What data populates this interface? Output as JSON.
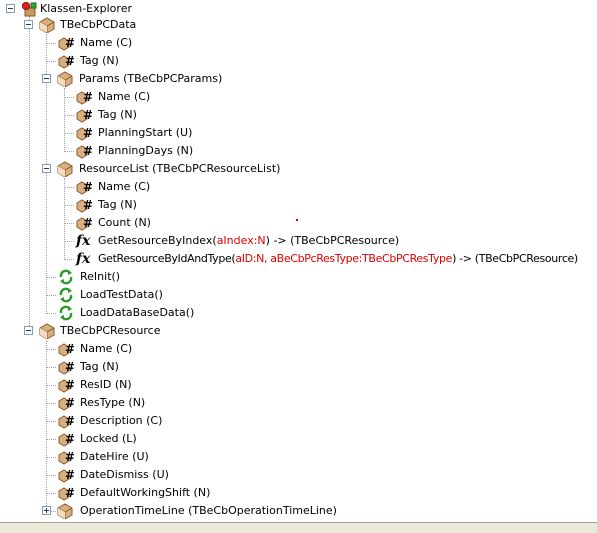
{
  "tree": {
    "root": "Klassen-Explorer",
    "items": [
      {
        "label": "TBeCbPCData",
        "type": "box"
      },
      {
        "label": "Name (C)",
        "type": "field"
      },
      {
        "label": "Tag (N)",
        "type": "field"
      },
      {
        "label": "Params (TBeCbPCParams)",
        "type": "box"
      },
      {
        "label": "Name (C)",
        "type": "field"
      },
      {
        "label": "Tag (N)",
        "type": "field"
      },
      {
        "label": "PlanningStart (U)",
        "type": "field"
      },
      {
        "label": "PlanningDays (N)",
        "type": "field"
      },
      {
        "label": "ResourceList (TBeCbPCResourceList)",
        "type": "box"
      },
      {
        "label": "Name (C)",
        "type": "field"
      },
      {
        "label": "Tag (N)",
        "type": "field"
      },
      {
        "label": "Count (N)",
        "type": "field"
      },
      {
        "label": "GetResourceByIndex(",
        "param": "aIndex:N",
        "suffix": ") -> (TBeCbPCResource)",
        "type": "function"
      },
      {
        "label": "GetResourceByIdAndType(",
        "param": "aID:N, aBeCbPcResType:TBeCbPCResType",
        "suffix": ") -> (TBeCbPCResource)",
        "type": "function"
      },
      {
        "label": "ReInit()",
        "type": "method"
      },
      {
        "label": "LoadTestData()",
        "type": "method"
      },
      {
        "label": "LoadDataBaseData()",
        "type": "method"
      },
      {
        "label": "TBeCbPCResource",
        "type": "box"
      },
      {
        "label": "Name (C)",
        "type": "field"
      },
      {
        "label": "Tag (N)",
        "type": "field"
      },
      {
        "label": "ResID (N)",
        "type": "field"
      },
      {
        "label": "ResType (N)",
        "type": "field"
      },
      {
        "label": "Description (C)",
        "type": "field"
      },
      {
        "label": "Locked (L)",
        "type": "field"
      },
      {
        "label": "DateHire (U)",
        "type": "field"
      },
      {
        "label": "DateDismiss (U)",
        "type": "field"
      },
      {
        "label": "DefaultWorkingShift (N)",
        "type": "field"
      },
      {
        "label": "OperationTimeLine (TBeCbOperationTimeLine)",
        "type": "box"
      }
    ]
  },
  "icons": {
    "box": "package-box-icon",
    "field": "hash-field-icon",
    "function": "fx-function-icon",
    "method": "green-refresh-method-icon",
    "root": "class-explorer-icon"
  },
  "colors": {
    "param_red": "#e00000",
    "box_light": "#f2ddc0",
    "box_dark": "#b8864a",
    "method_green": "#2a9a2a"
  }
}
